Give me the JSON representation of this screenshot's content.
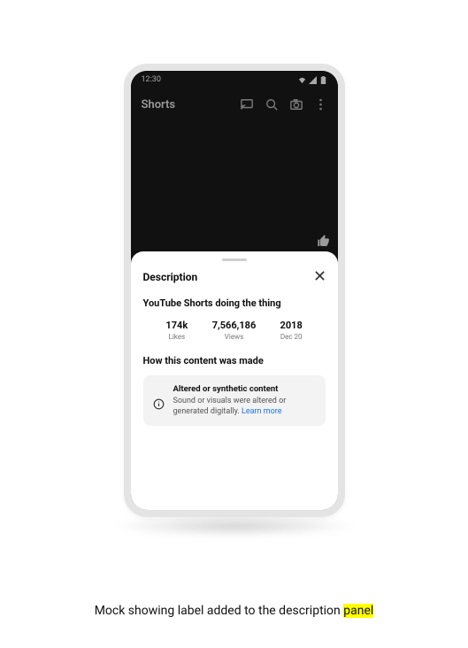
{
  "status": {
    "time": "12:30"
  },
  "appbar": {
    "title": "Shorts"
  },
  "sheet": {
    "header": "Description",
    "video_title": "YouTube Shorts doing the thing",
    "stats": {
      "likes": {
        "value": "174k",
        "label": "Likes"
      },
      "views": {
        "value": "7,566,186",
        "label": "Views"
      },
      "date": {
        "value": "2018",
        "label": "Dec 20"
      }
    },
    "section_heading": "How this content was made",
    "card": {
      "title": "Altered or synthetic content",
      "body": "Sound or visuals were altered or generated digitally.",
      "link": "Learn more"
    }
  },
  "caption": {
    "text": "Mock showing label added to the description ",
    "highlight": "panel"
  }
}
